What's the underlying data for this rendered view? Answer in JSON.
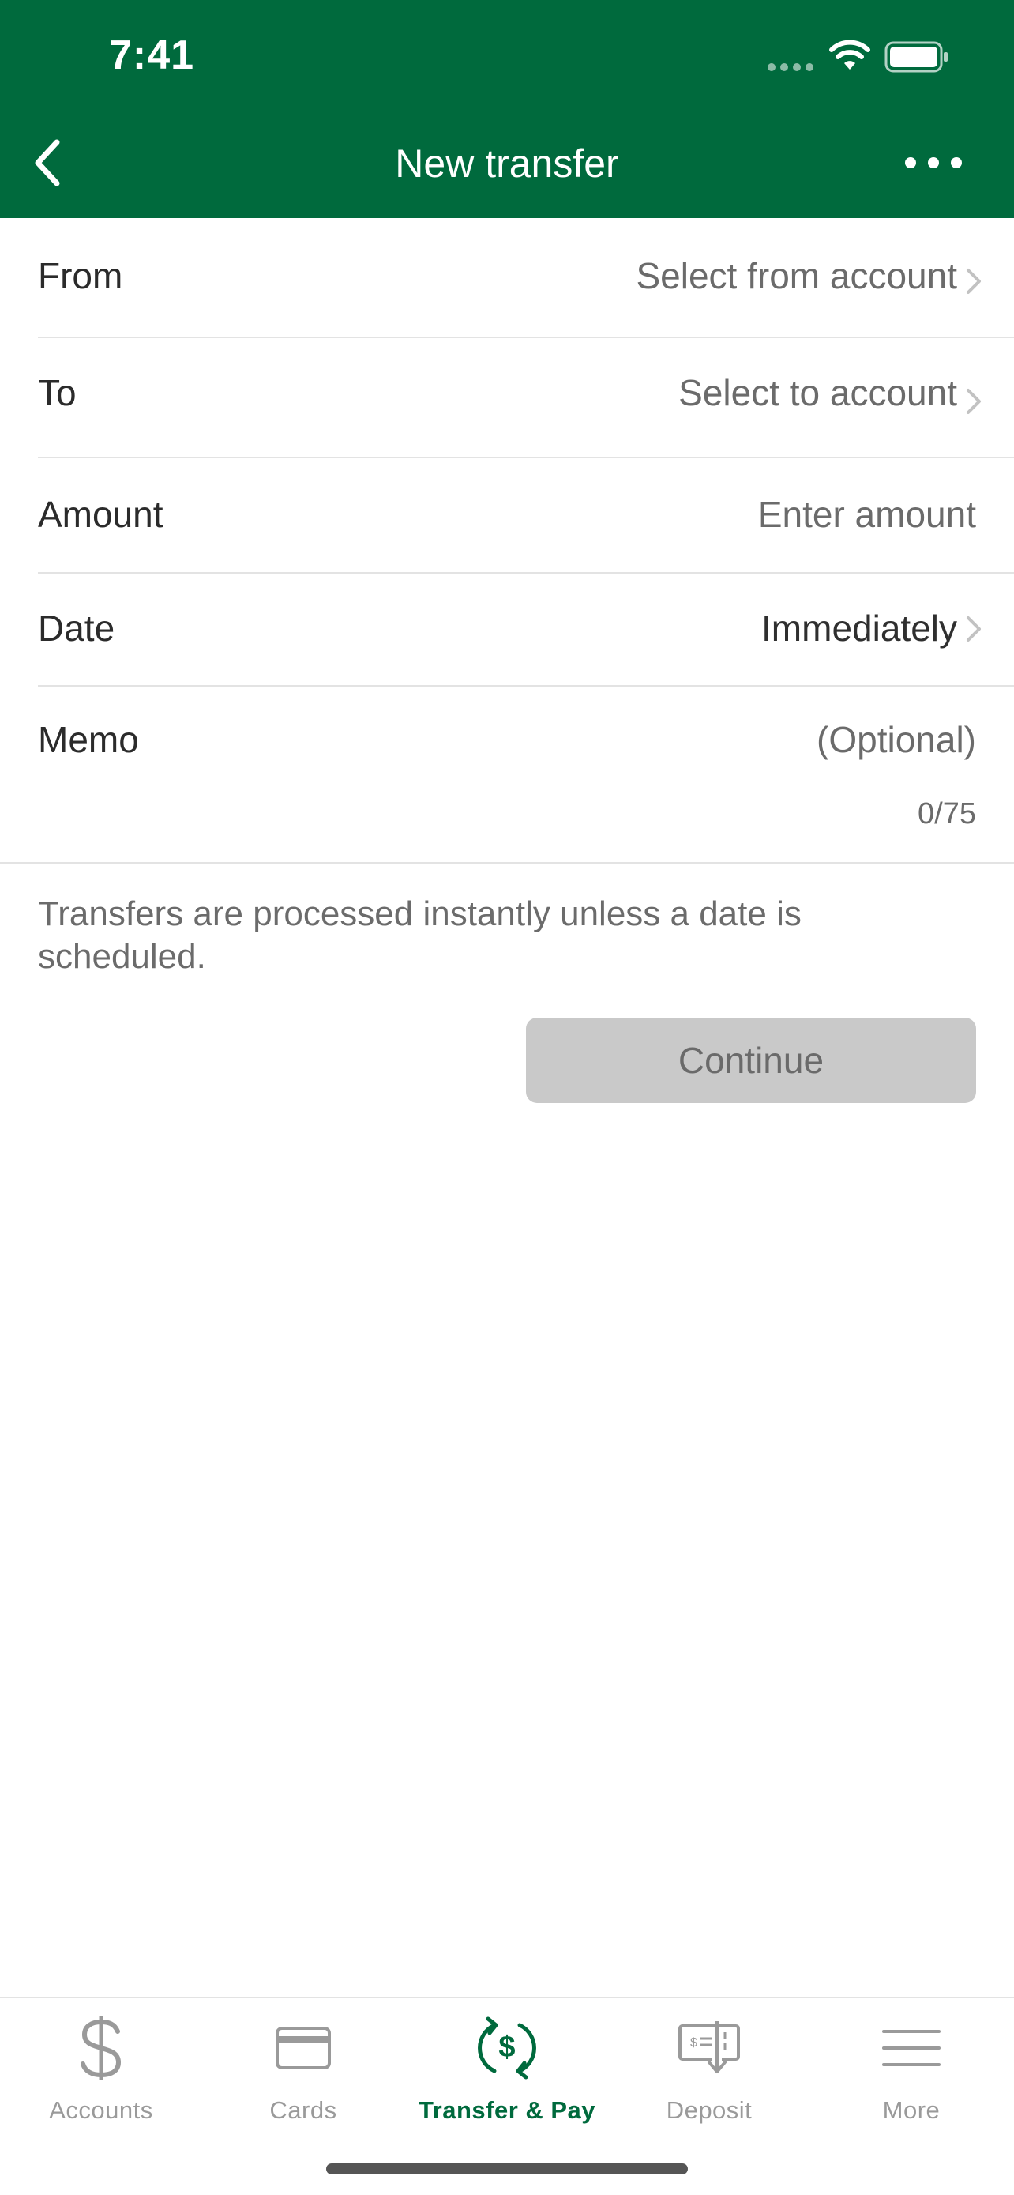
{
  "status_bar": {
    "time": "7:41"
  },
  "header": {
    "title": "New transfer",
    "back_icon": "chevron-left-icon",
    "more_icon": "ellipsis-icon",
    "bg_color": "#006a3d"
  },
  "form": {
    "from": {
      "label": "From",
      "value": "Select from account"
    },
    "to": {
      "label": "To",
      "value": "Select to account"
    },
    "amount": {
      "label": "Amount",
      "placeholder": "Enter amount"
    },
    "date": {
      "label": "Date",
      "value": "Immediately"
    },
    "memo": {
      "label": "Memo",
      "placeholder": "(Optional)",
      "counter": "0/75"
    }
  },
  "info_text": "Transfers are processed instantly unless a date is scheduled.",
  "continue_label": "Continue",
  "tab_bar": {
    "active": "Transfer & Pay",
    "accent_color": "#006a3d",
    "tabs": [
      {
        "label": "Accounts",
        "icon": "dollar-icon"
      },
      {
        "label": "Cards",
        "icon": "card-icon"
      },
      {
        "label": "Transfer & Pay",
        "icon": "transfer-dollar-icon"
      },
      {
        "label": "Deposit",
        "icon": "check-deposit-icon"
      },
      {
        "label": "More",
        "icon": "menu-icon"
      }
    ]
  }
}
